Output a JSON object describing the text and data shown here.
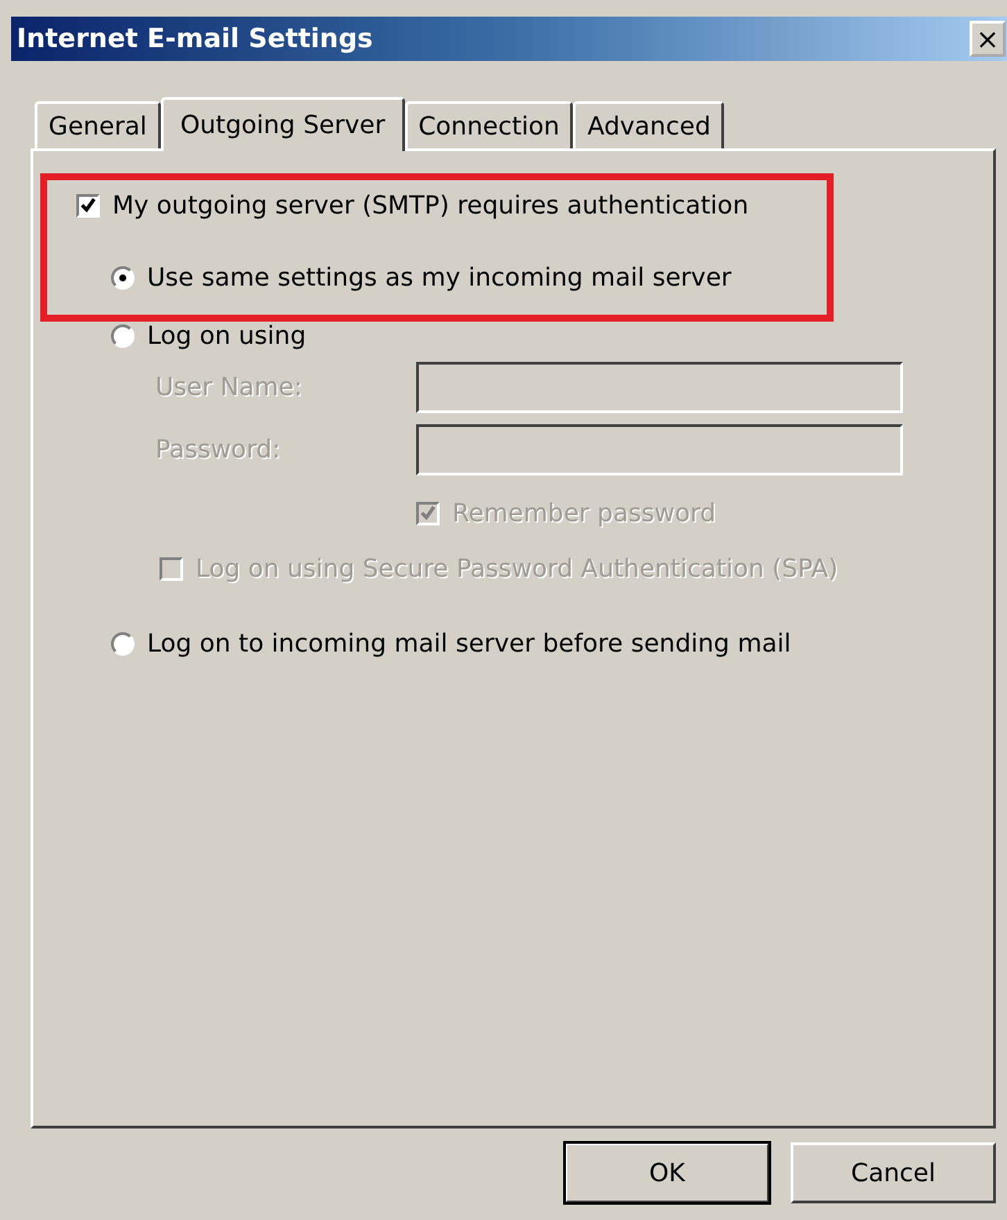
{
  "window": {
    "title": "Internet E-mail Settings",
    "close": "×"
  },
  "tabs": [
    {
      "label": "General",
      "selected": false
    },
    {
      "label": "Outgoing Server",
      "selected": true
    },
    {
      "label": "Connection",
      "selected": false
    },
    {
      "label": "Advanced",
      "selected": false
    }
  ],
  "auth_checkbox": {
    "label": "My outgoing server (SMTP) requires authentication",
    "checked": true
  },
  "radios": [
    {
      "label": "Use same settings as my incoming mail server",
      "selected": true,
      "kind": "plain"
    },
    {
      "label": "Log on using",
      "selected": false,
      "kind": "credentials"
    },
    {
      "label": "Log on to incoming mail server before sending mail",
      "selected": false,
      "kind": "plain"
    }
  ],
  "credentials": {
    "fields": [
      {
        "label": "User Name:",
        "disabled": true
      },
      {
        "label": "Password:",
        "disabled": true
      }
    ],
    "remember": {
      "label": "Remember password",
      "checked": true,
      "disabled": true
    },
    "spa": {
      "label": "Log on using Secure Password Authentication (SPA)",
      "checked": false,
      "disabled": true
    }
  },
  "buttons": [
    {
      "label": "OK",
      "default": true
    },
    {
      "label": "Cancel",
      "default": false
    }
  ]
}
